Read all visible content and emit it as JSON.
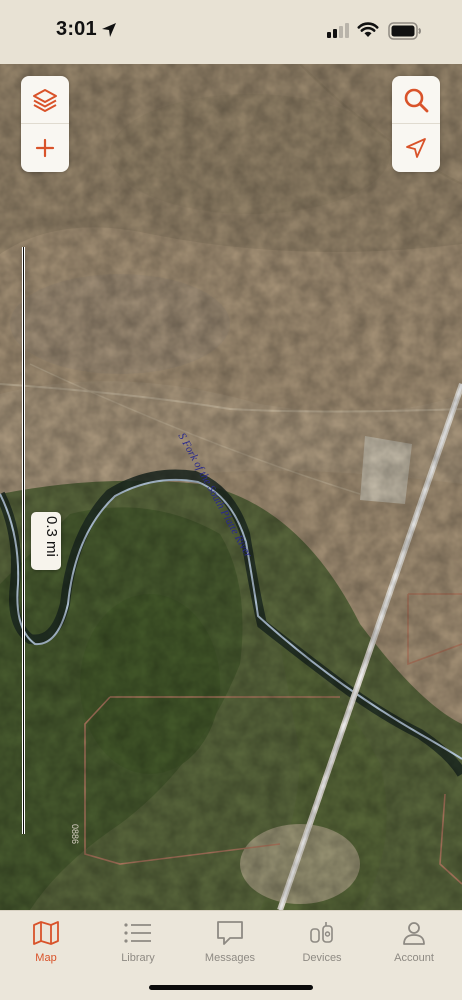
{
  "status_bar": {
    "time": "3:01",
    "location_icon": "location-arrow-icon",
    "signal_icon": "cellular-signal-icon",
    "wifi_icon": "wifi-icon",
    "battery_icon": "battery-icon"
  },
  "map": {
    "river_label": "S Fork of the South Platte River",
    "road_label": "0886",
    "scale_label": "0.3 mi",
    "controls": {
      "layers_icon": "layers-icon",
      "add_icon": "plus-icon",
      "search_icon": "search-icon",
      "locate_icon": "navigation-arrow-icon"
    },
    "accent_color": "#d9532a"
  },
  "tab_bar": {
    "tabs": [
      {
        "label": "Map",
        "icon": "map-icon",
        "active": true
      },
      {
        "label": "Library",
        "icon": "list-icon",
        "active": false
      },
      {
        "label": "Messages",
        "icon": "message-icon",
        "active": false
      },
      {
        "label": "Devices",
        "icon": "devices-icon",
        "active": false
      },
      {
        "label": "Account",
        "icon": "person-icon",
        "active": false
      }
    ]
  }
}
